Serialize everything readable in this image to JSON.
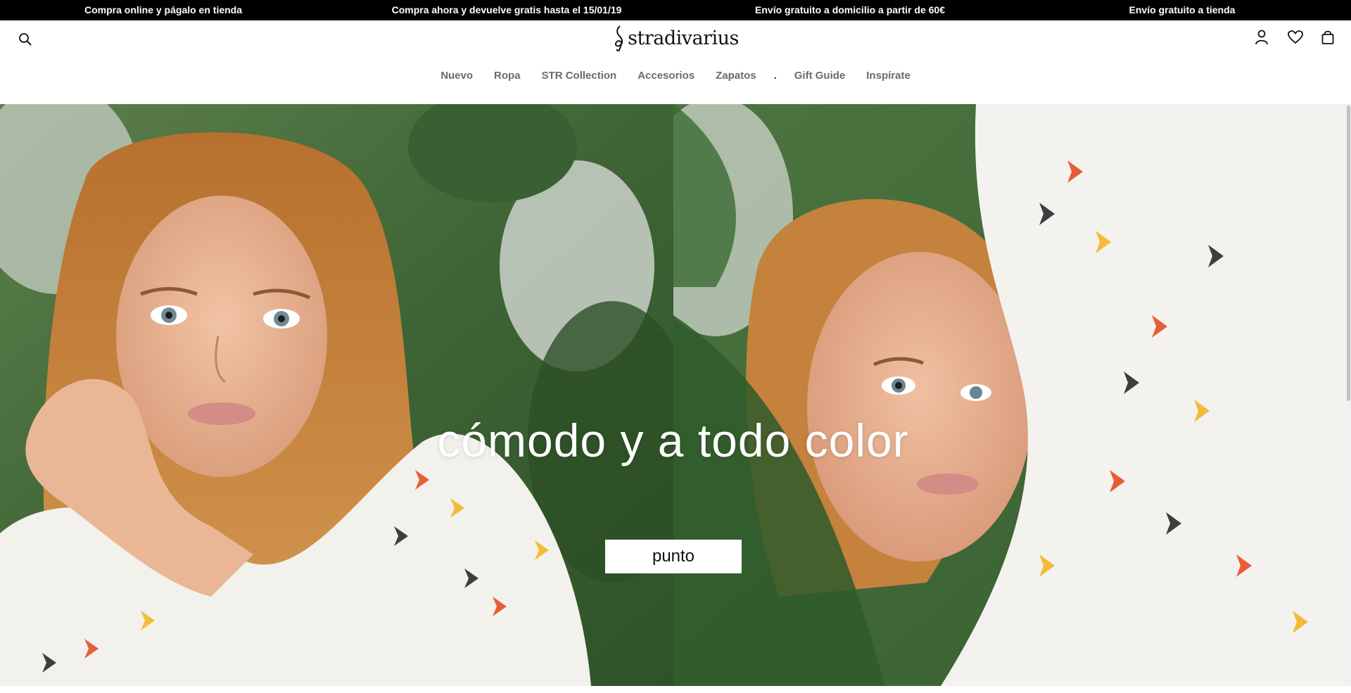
{
  "promo_bar": {
    "items": [
      "Compra online y págalo en tienda",
      "Compra ahora y devuelve gratis hasta el 15/01/19",
      "Envío gratuito a domicilio a partir de 60€",
      "Envío gratuito a tienda"
    ]
  },
  "header": {
    "logo_text": "stradivarius",
    "icons": {
      "search": "search-icon",
      "account": "user-icon",
      "wishlist": "heart-icon",
      "bag": "shopping-bag-icon"
    }
  },
  "nav": {
    "items": [
      "Nuevo",
      "Ropa",
      "STR Collection",
      "Accesorios",
      "Zapatos",
      ".",
      "Gift Guide",
      "Inspírate"
    ]
  },
  "hero": {
    "headline": "cómodo y a todo color",
    "button_label": "punto"
  },
  "colors": {
    "promo_bg": "#000000",
    "nav_text": "#6b6b6b",
    "hero_text": "#ffffff",
    "foliage": "#3f6b3a",
    "hair": "#c4823c",
    "sweater": "#f3f1ec"
  }
}
